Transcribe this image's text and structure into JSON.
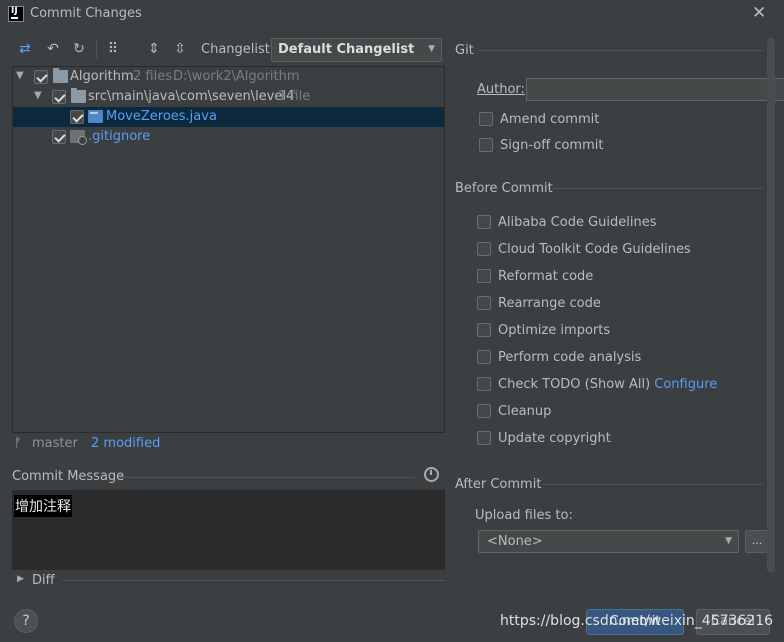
{
  "window": {
    "title": "Commit Changes",
    "app_icon_letter": "IJ"
  },
  "toolbar": {
    "changelist_label": "Changelist:",
    "changelist_value": "Default Changelist",
    "icons": [
      "move-icon",
      "undo-icon",
      "refresh-icon",
      "group-by-icon",
      "expand-all-icon",
      "collapse-all-icon"
    ]
  },
  "tree": {
    "root": {
      "name": "Algorithm",
      "count": "2 files",
      "path": "D:\\work2\\Algorithm"
    },
    "folder": {
      "name": "src\\main\\java\\com\\seven\\level4",
      "count": "1 file"
    },
    "file1": {
      "name": "MoveZeroes.java"
    },
    "file2": {
      "name": ".gitignore"
    }
  },
  "status": {
    "branch": "master",
    "modified": "2 modified"
  },
  "commit_message": {
    "label": "Commit Message",
    "value": "增加注释"
  },
  "diff": {
    "label": "Diff"
  },
  "git_section": {
    "label": "Git",
    "author_label": "Author:",
    "author_value": "",
    "amend": "Amend commit",
    "signoff": "Sign-off commit"
  },
  "before_commit": {
    "label": "Before Commit",
    "options": [
      "Alibaba Code Guidelines",
      "Cloud Toolkit Code Guidelines",
      "Reformat code",
      "Rearrange code",
      "Optimize imports",
      "Perform code analysis",
      "Check TODO (Show All)",
      "Cleanup",
      "Update copyright"
    ],
    "configure_link": "Configure"
  },
  "after_commit": {
    "label": "After Commit",
    "upload_label": "Upload files to:",
    "upload_value": "<None>",
    "dots": "..."
  },
  "buttons": {
    "commit": "Commit",
    "cancel": "Cancel",
    "help": "?"
  },
  "watermark": "https://blog.csdn.net/weixin_45736216",
  "colors": {
    "background": "#3c3f41",
    "selection": "#0d293e",
    "link": "#589df6",
    "primary_button": "#365880"
  }
}
